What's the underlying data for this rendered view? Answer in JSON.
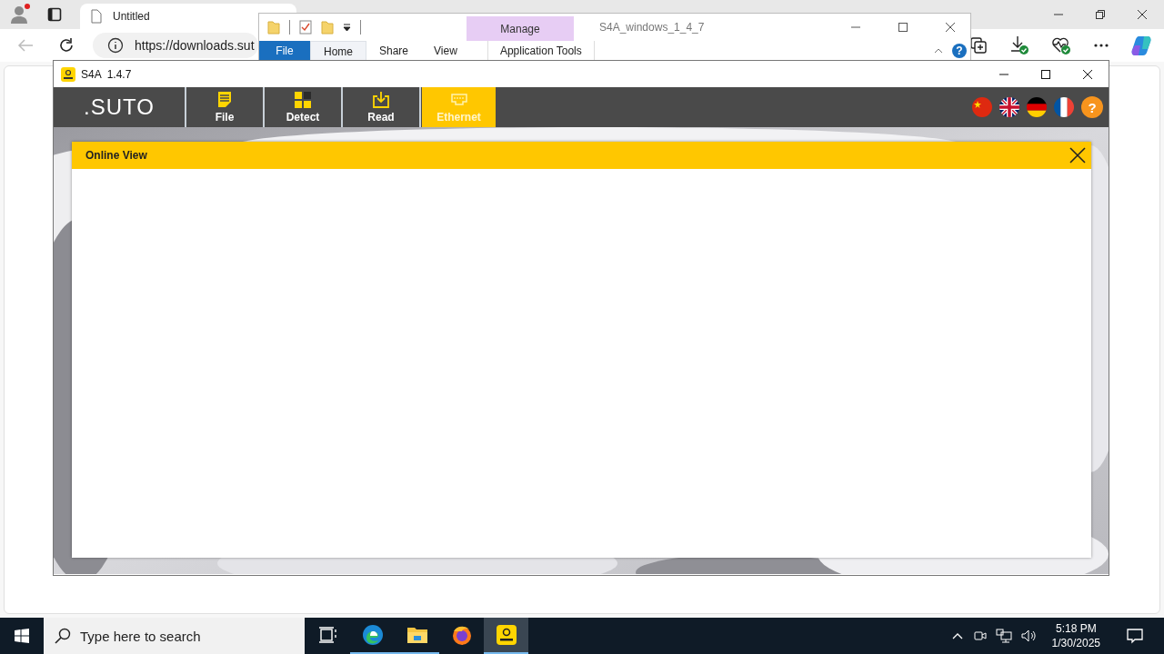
{
  "browser": {
    "tab": {
      "title": "Untitled"
    },
    "back": {
      "disabled": true
    },
    "address": {
      "value": "https://downloads.sut"
    }
  },
  "explorer": {
    "title": "S4A_windows_1_4_7",
    "tabs": [
      {
        "label": "File",
        "kind": "file",
        "selected": false
      },
      {
        "label": "Home",
        "kind": "tab",
        "selected": true
      },
      {
        "label": "Share",
        "kind": "tab",
        "selected": false
      },
      {
        "label": "View",
        "kind": "tab",
        "selected": false
      }
    ],
    "context": {
      "header": "Manage",
      "tab": "Application Tools"
    },
    "help": "?"
  },
  "app": {
    "title": "S4A  1.4.7",
    "logo": ".SUTO",
    "nav": [
      {
        "label": "File",
        "kind": "file",
        "selected": false
      },
      {
        "label": "Detect",
        "kind": "detect",
        "selected": false
      },
      {
        "label": "Read",
        "kind": "read",
        "selected": false
      },
      {
        "label": "Ethernet",
        "kind": "ethernet",
        "selected": true
      }
    ],
    "languages": [
      {
        "kind": "cn"
      },
      {
        "kind": "gb"
      },
      {
        "kind": "de"
      },
      {
        "kind": "fr"
      }
    ],
    "help": "?",
    "dialog": {
      "title": "Online View"
    }
  },
  "taskbar": {
    "search": {
      "placeholder": "Type here to search"
    },
    "apps": [
      {
        "kind": "taskview",
        "running": false,
        "selected": false
      },
      {
        "kind": "edge",
        "running": true,
        "selected": false
      },
      {
        "kind": "explorer",
        "running": true,
        "selected": false
      },
      {
        "kind": "firefox",
        "running": false,
        "selected": false
      },
      {
        "kind": "s4a",
        "running": true,
        "selected": true
      }
    ],
    "time": "5:18 PM",
    "date": "1/30/2025"
  }
}
